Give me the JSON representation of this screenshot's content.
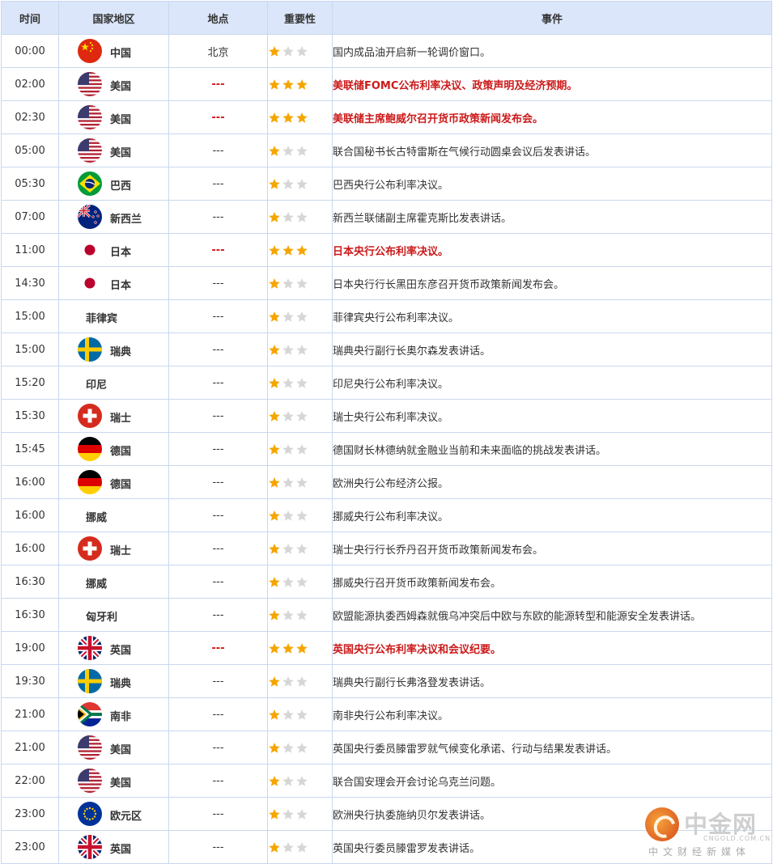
{
  "table": {
    "headers": [
      "时间",
      "国家地区",
      "地点",
      "重要性",
      "事件"
    ]
  },
  "colors": {
    "header_bg": "#dbe6fa",
    "highlight": "#cc1a1a",
    "star_on": "#f5a500",
    "star_off": "#d6d6d6",
    "border": "#c9d8ee"
  },
  "rows": [
    {
      "time": "00:00",
      "country": "中国",
      "flag": "china-flag-icon",
      "place": "北京",
      "stars": 1,
      "event": "国内成品油开启新一轮调价窗口。",
      "hi": false
    },
    {
      "time": "02:00",
      "country": "美国",
      "flag": "usa-flag-icon",
      "place": "---",
      "stars": 3,
      "event": "美联储FOMC公布利率决议、政策声明及经济预期。",
      "hi": true
    },
    {
      "time": "02:30",
      "country": "美国",
      "flag": "usa-flag-icon",
      "place": "---",
      "stars": 3,
      "event": "美联储主席鲍威尔召开货币政策新闻发布会。",
      "hi": true
    },
    {
      "time": "05:00",
      "country": "美国",
      "flag": "usa-flag-icon",
      "place": "---",
      "stars": 1,
      "event": "联合国秘书长古特雷斯在气候行动圆桌会议后发表讲话。",
      "hi": false
    },
    {
      "time": "05:30",
      "country": "巴西",
      "flag": "brazil-flag-icon",
      "place": "---",
      "stars": 1,
      "event": "巴西央行公布利率决议。",
      "hi": false
    },
    {
      "time": "07:00",
      "country": "新西兰",
      "flag": "new-zealand-flag-icon",
      "place": "---",
      "stars": 1,
      "event": "新西兰联储副主席霍克斯比发表讲话。",
      "hi": false
    },
    {
      "time": "11:00",
      "country": "日本",
      "flag": "japan-flag-icon",
      "place": "---",
      "stars": 3,
      "event": "日本央行公布利率决议。",
      "hi": true
    },
    {
      "time": "14:30",
      "country": "日本",
      "flag": "japan-flag-icon",
      "place": "---",
      "stars": 1,
      "event": "日本央行行长黑田东彦召开货币政策新闻发布会。",
      "hi": false
    },
    {
      "time": "15:00",
      "country": "菲律宾",
      "flag": "",
      "place": "---",
      "stars": 1,
      "event": "菲律宾央行公布利率决议。",
      "hi": false
    },
    {
      "time": "15:00",
      "country": "瑞典",
      "flag": "sweden-flag-icon",
      "place": "---",
      "stars": 1,
      "event": "瑞典央行副行长奥尔森发表讲话。",
      "hi": false
    },
    {
      "time": "15:20",
      "country": "印尼",
      "flag": "",
      "place": "---",
      "stars": 1,
      "event": "印尼央行公布利率决议。",
      "hi": false
    },
    {
      "time": "15:30",
      "country": "瑞士",
      "flag": "switzerland-flag-icon",
      "place": "---",
      "stars": 1,
      "event": "瑞士央行公布利率决议。",
      "hi": false
    },
    {
      "time": "15:45",
      "country": "德国",
      "flag": "germany-flag-icon",
      "place": "---",
      "stars": 1,
      "event": "德国财长林德纳就金融业当前和未来面临的挑战发表讲话。",
      "hi": false
    },
    {
      "time": "16:00",
      "country": "德国",
      "flag": "germany-flag-icon",
      "place": "---",
      "stars": 1,
      "event": "欧洲央行公布经济公报。",
      "hi": false
    },
    {
      "time": "16:00",
      "country": "挪威",
      "flag": "",
      "place": "---",
      "stars": 1,
      "event": "挪威央行公布利率决议。",
      "hi": false
    },
    {
      "time": "16:00",
      "country": "瑞士",
      "flag": "switzerland-flag-icon",
      "place": "---",
      "stars": 1,
      "event": "瑞士央行行长乔丹召开货币政策新闻发布会。",
      "hi": false
    },
    {
      "time": "16:30",
      "country": "挪威",
      "flag": "",
      "place": "---",
      "stars": 1,
      "event": "挪威央行召开货币政策新闻发布会。",
      "hi": false
    },
    {
      "time": "16:30",
      "country": "匈牙利",
      "flag": "",
      "place": "---",
      "stars": 1,
      "event": "欧盟能源执委西姆森就俄乌冲突后中欧与东欧的能源转型和能源安全发表讲话。",
      "hi": false
    },
    {
      "time": "19:00",
      "country": "英国",
      "flag": "uk-flag-icon",
      "place": "---",
      "stars": 3,
      "event": "英国央行公布利率决议和会议纪要。",
      "hi": true
    },
    {
      "time": "19:30",
      "country": "瑞典",
      "flag": "sweden-flag-icon",
      "place": "---",
      "stars": 1,
      "event": "瑞典央行副行长弗洛登发表讲话。",
      "hi": false
    },
    {
      "time": "21:00",
      "country": "南非",
      "flag": "south-africa-flag-icon",
      "place": "---",
      "stars": 1,
      "event": "南非央行公布利率决议。",
      "hi": false
    },
    {
      "time": "21:00",
      "country": "美国",
      "flag": "usa-flag-icon",
      "place": "---",
      "stars": 1,
      "event": "英国央行委员滕雷罗就气候变化承诺、行动与结果发表讲话。",
      "hi": false
    },
    {
      "time": "22:00",
      "country": "美国",
      "flag": "usa-flag-icon",
      "place": "---",
      "stars": 1,
      "event": "联合国安理会开会讨论乌克兰问题。",
      "hi": false
    },
    {
      "time": "23:00",
      "country": "欧元区",
      "flag": "eu-flag-icon",
      "place": "---",
      "stars": 1,
      "event": "欧洲央行执委施纳贝尔发表讲话。",
      "hi": false
    },
    {
      "time": "23:00",
      "country": "英国",
      "flag": "uk-flag-icon",
      "place": "---",
      "stars": 1,
      "event": "英国央行委员滕雷罗发表讲话。",
      "hi": false
    }
  ],
  "watermark": {
    "brand": "中金网",
    "domain": "CNGOLD.COM.CN",
    "slogan": "中文财经新媒体",
    "icon": "cngold-logo-icon"
  }
}
